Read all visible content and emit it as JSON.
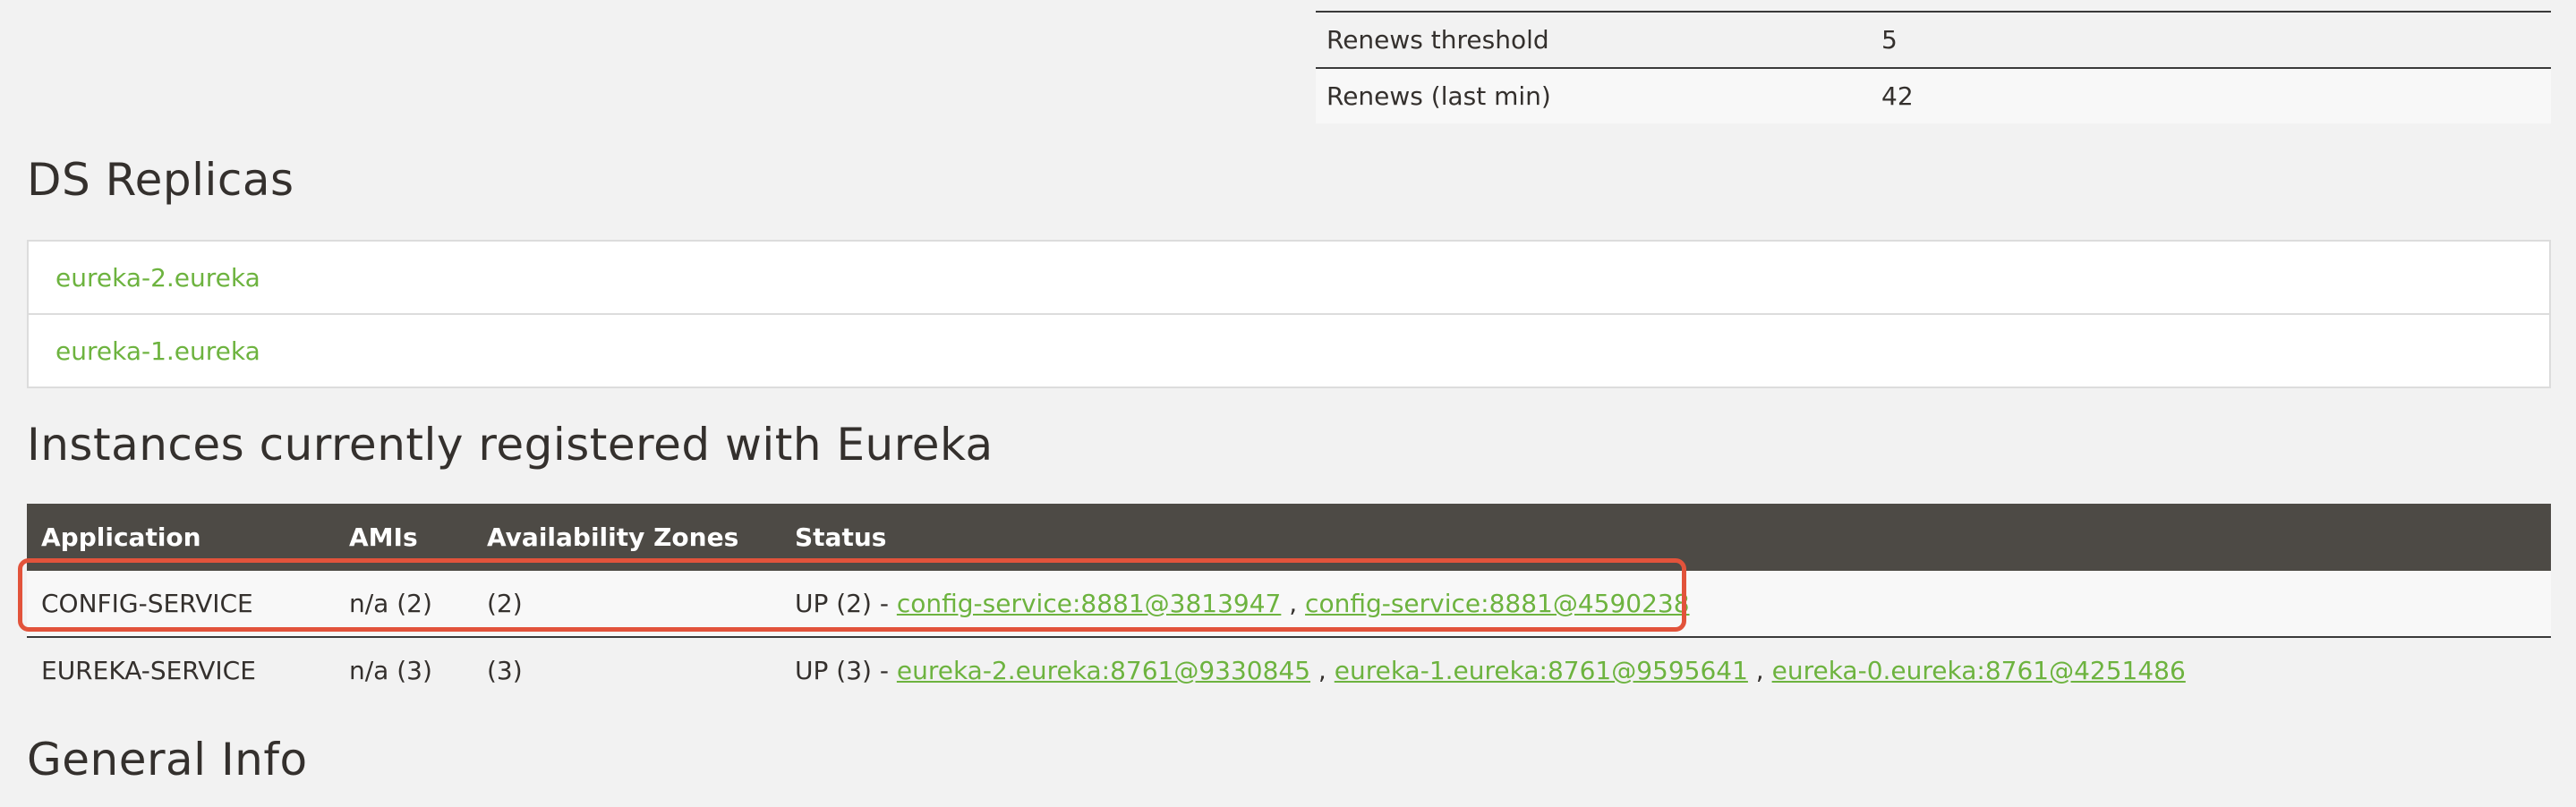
{
  "stats": [
    {
      "label": "Renews threshold",
      "value": "5"
    },
    {
      "label": "Renews (last min)",
      "value": "42"
    }
  ],
  "replicas": {
    "title": "DS Replicas",
    "items": [
      "eureka-2.eureka",
      "eureka-1.eureka"
    ]
  },
  "instances": {
    "title": "Instances currently registered with Eureka",
    "columns": [
      "Application",
      "AMIs",
      "Availability Zones",
      "Status"
    ],
    "rows": [
      {
        "application": "CONFIG-SERVICE",
        "amis": "n/a (2)",
        "zones": "(2)",
        "status_prefix": "UP (2) - ",
        "links": [
          "config-service:8881@3813947",
          "config-service:8881@4590238"
        ],
        "sep": " , "
      },
      {
        "application": "EUREKA-SERVICE",
        "amis": "n/a (3)",
        "zones": "(3)",
        "status_prefix": "UP (3) - ",
        "links": [
          "eureka-2.eureka:8761@9330845",
          "eureka-1.eureka:8761@9595641",
          "eureka-0.eureka:8761@4251486"
        ],
        "sep": " , "
      }
    ]
  },
  "general": {
    "title": "General Info"
  },
  "colors": {
    "link": "#6db33f",
    "header_bg": "#4d4a45",
    "highlight": "#e2533b"
  }
}
